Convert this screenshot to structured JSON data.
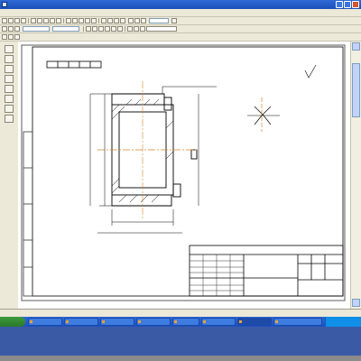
{
  "window": {
    "title": "",
    "buttons": {
      "minimize": "",
      "maximize": "",
      "close": ""
    }
  },
  "menu": {
    "items": [
      "",
      "",
      "",
      "",
      "",
      "",
      "",
      "",
      "",
      "",
      ""
    ]
  },
  "toolbar": {
    "zoom_value": "",
    "sheet_tab_label": ""
  },
  "drawing": {
    "stamp_number": "",
    "sheet_mark": "",
    "title_block": {
      "designation": "",
      "part_name": "",
      "material": "",
      "mass": "",
      "scale": "",
      "sheet": "",
      "sheets": "",
      "org": ""
    },
    "note_lines": [
      "",
      "",
      ""
    ],
    "dimensions": [
      "",
      "",
      "",
      "",
      "",
      "",
      "",
      "",
      "",
      "",
      "",
      "",
      ""
    ],
    "callouts": [
      "",
      "",
      "",
      ""
    ]
  },
  "status": {
    "text": ""
  },
  "taskbar": {
    "start_label": "",
    "tasks": [
      "",
      "",
      "",
      "",
      "",
      "",
      "",
      ""
    ],
    "active_task_index": 6,
    "clock": ""
  }
}
